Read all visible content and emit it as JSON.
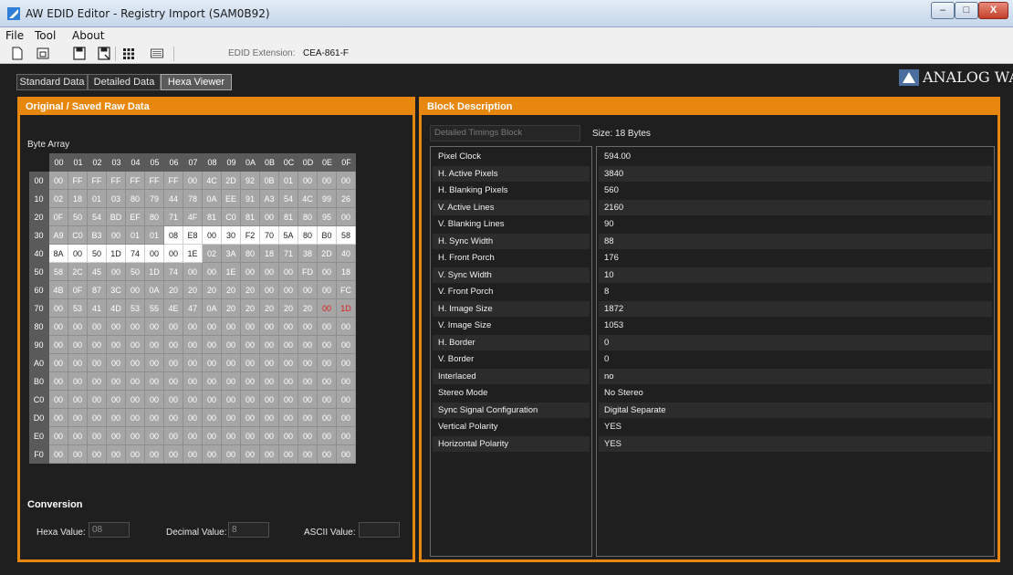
{
  "window": {
    "title": "AW EDID Editor - Registry Import (SAM0B92)",
    "controls": {
      "minimize": "–",
      "maximize": "□",
      "close": "X"
    }
  },
  "menu": [
    "File",
    "Tool",
    "About"
  ],
  "toolbar": {
    "icons": [
      "new-file-icon",
      "open-file-icon",
      "save-icon",
      "save-as-icon",
      "grid-icon",
      "keyboard-icon"
    ],
    "edid_extension_label": "EDID Extension:",
    "edid_extension_value": "CEA-861-F"
  },
  "tabs": [
    {
      "label": "Standard Data",
      "active": false
    },
    {
      "label": "Detailed Data",
      "active": false
    },
    {
      "label": "Hexa Viewer",
      "active": true
    }
  ],
  "logo": {
    "text": "ANALOG WAY"
  },
  "left_panel": {
    "title": "Original / Saved Raw Data",
    "byte_array_label": "Byte Array",
    "columns": [
      "00",
      "01",
      "02",
      "03",
      "04",
      "05",
      "06",
      "07",
      "08",
      "09",
      "0A",
      "0B",
      "0C",
      "0D",
      "0E",
      "0F"
    ],
    "rows": [
      {
        "label": "00",
        "bytes": [
          "00",
          "FF",
          "FF",
          "FF",
          "FF",
          "FF",
          "FF",
          "00",
          "4C",
          "2D",
          "92",
          "0B",
          "01",
          "00",
          "00",
          "00"
        ]
      },
      {
        "label": "10",
        "bytes": [
          "02",
          "18",
          "01",
          "03",
          "80",
          "79",
          "44",
          "78",
          "0A",
          "EE",
          "91",
          "A3",
          "54",
          "4C",
          "99",
          "26"
        ]
      },
      {
        "label": "20",
        "bytes": [
          "0F",
          "50",
          "54",
          "BD",
          "EF",
          "80",
          "71",
          "4F",
          "81",
          "C0",
          "81",
          "00",
          "81",
          "80",
          "95",
          "00"
        ]
      },
      {
        "label": "30",
        "bytes": [
          "A9",
          "C0",
          "B3",
          "00",
          "01",
          "01",
          "08",
          "E8",
          "00",
          "30",
          "F2",
          "70",
          "5A",
          "80",
          "B0",
          "58"
        ]
      },
      {
        "label": "40",
        "bytes": [
          "8A",
          "00",
          "50",
          "1D",
          "74",
          "00",
          "00",
          "1E",
          "02",
          "3A",
          "80",
          "18",
          "71",
          "38",
          "2D",
          "40"
        ]
      },
      {
        "label": "50",
        "bytes": [
          "58",
          "2C",
          "45",
          "00",
          "50",
          "1D",
          "74",
          "00",
          "00",
          "1E",
          "00",
          "00",
          "00",
          "FD",
          "00",
          "18"
        ]
      },
      {
        "label": "60",
        "bytes": [
          "4B",
          "0F",
          "87",
          "3C",
          "00",
          "0A",
          "20",
          "20",
          "20",
          "20",
          "20",
          "00",
          "00",
          "00",
          "00",
          "FC"
        ]
      },
      {
        "label": "70",
        "bytes": [
          "00",
          "53",
          "41",
          "4D",
          "53",
          "55",
          "4E",
          "47",
          "0A",
          "20",
          "20",
          "20",
          "20",
          "20",
          "00",
          "1D"
        ]
      },
      {
        "label": "80",
        "bytes": [
          "00",
          "00",
          "00",
          "00",
          "00",
          "00",
          "00",
          "00",
          "00",
          "00",
          "00",
          "00",
          "00",
          "00",
          "00",
          "00"
        ]
      },
      {
        "label": "90",
        "bytes": [
          "00",
          "00",
          "00",
          "00",
          "00",
          "00",
          "00",
          "00",
          "00",
          "00",
          "00",
          "00",
          "00",
          "00",
          "00",
          "00"
        ]
      },
      {
        "label": "A0",
        "bytes": [
          "00",
          "00",
          "00",
          "00",
          "00",
          "00",
          "00",
          "00",
          "00",
          "00",
          "00",
          "00",
          "00",
          "00",
          "00",
          "00"
        ]
      },
      {
        "label": "B0",
        "bytes": [
          "00",
          "00",
          "00",
          "00",
          "00",
          "00",
          "00",
          "00",
          "00",
          "00",
          "00",
          "00",
          "00",
          "00",
          "00",
          "00"
        ]
      },
      {
        "label": "C0",
        "bytes": [
          "00",
          "00",
          "00",
          "00",
          "00",
          "00",
          "00",
          "00",
          "00",
          "00",
          "00",
          "00",
          "00",
          "00",
          "00",
          "00"
        ]
      },
      {
        "label": "D0",
        "bytes": [
          "00",
          "00",
          "00",
          "00",
          "00",
          "00",
          "00",
          "00",
          "00",
          "00",
          "00",
          "00",
          "00",
          "00",
          "00",
          "00"
        ]
      },
      {
        "label": "E0",
        "bytes": [
          "00",
          "00",
          "00",
          "00",
          "00",
          "00",
          "00",
          "00",
          "00",
          "00",
          "00",
          "00",
          "00",
          "00",
          "00",
          "00"
        ]
      },
      {
        "label": "F0",
        "bytes": [
          "00",
          "00",
          "00",
          "00",
          "00",
          "00",
          "00",
          "00",
          "00",
          "00",
          "00",
          "00",
          "00",
          "00",
          "00",
          "00"
        ]
      }
    ],
    "highlighted_range": {
      "start": 54,
      "end": 71
    },
    "red_cells": [
      126,
      127
    ],
    "conversion": {
      "title": "Conversion",
      "hexa_label": "Hexa Value:",
      "hexa_value": "08",
      "decimal_label": "Decimal Value:",
      "decimal_value": "8",
      "ascii_label": "ASCII Value:",
      "ascii_value": ""
    }
  },
  "right_panel": {
    "title": "Block Description",
    "block_name": "Detailed Timings Block",
    "size_text": "Size: 18 Bytes",
    "properties": [
      {
        "name": "Pixel Clock",
        "value": "594.00"
      },
      {
        "name": "H. Active Pixels",
        "value": "3840"
      },
      {
        "name": "H. Blanking Pixels",
        "value": "560"
      },
      {
        "name": "V. Active Lines",
        "value": "2160"
      },
      {
        "name": "V. Blanking Lines",
        "value": "90"
      },
      {
        "name": "H. Sync Width",
        "value": "88"
      },
      {
        "name": "H. Front Porch",
        "value": "176"
      },
      {
        "name": "V. Sync Width",
        "value": "10"
      },
      {
        "name": "V. Front Porch",
        "value": "8"
      },
      {
        "name": "H. Image Size",
        "value": "1872"
      },
      {
        "name": "V. Image Size",
        "value": "1053"
      },
      {
        "name": "H. Border",
        "value": "0"
      },
      {
        "name": "V. Border",
        "value": "0"
      },
      {
        "name": "Interlaced",
        "value": "no"
      },
      {
        "name": "Stereo Mode",
        "value": "No Stereo"
      },
      {
        "name": "Sync Signal Configuration",
        "value": "Digital Separate"
      },
      {
        "name": "Vertical Polarity",
        "value": "YES"
      },
      {
        "name": "Horizontal Polarity",
        "value": "YES"
      }
    ]
  },
  "colors": {
    "accent": "#e8870e",
    "background": "#1f1f1f",
    "highlight": "#ffffff",
    "error": "#e02020"
  }
}
